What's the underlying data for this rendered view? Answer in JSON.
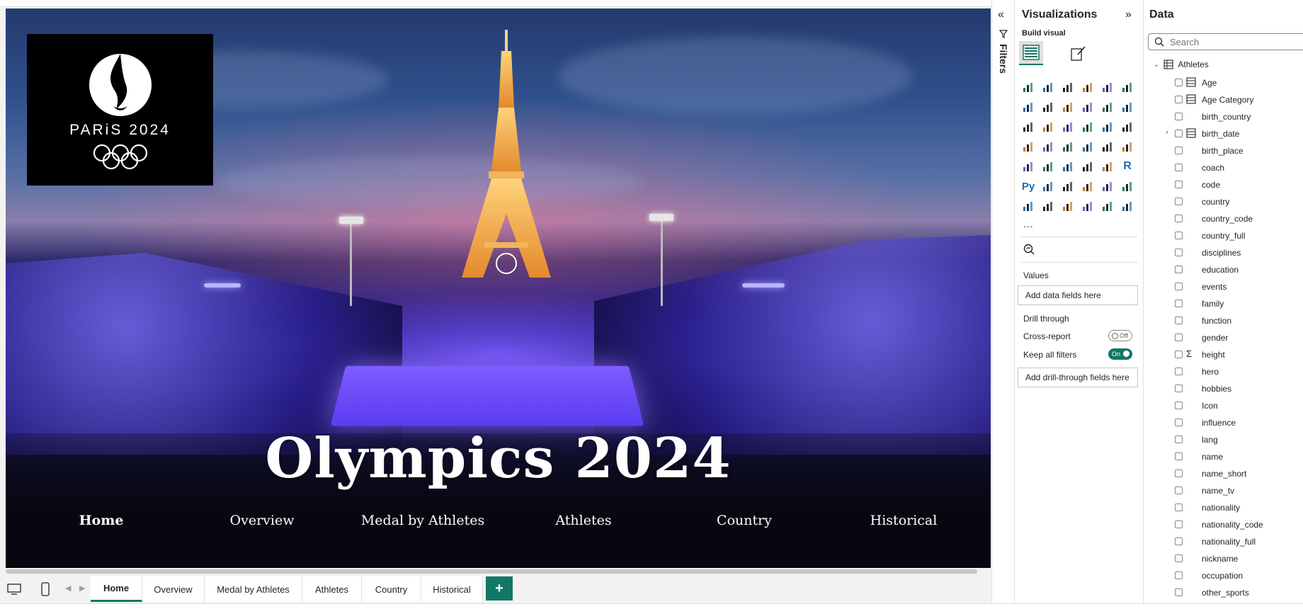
{
  "report": {
    "logo_text": "PARiS 2024",
    "hero_title": "Olympics 2024",
    "nav_links": [
      "Home",
      "Overview",
      "Medal by Athletes",
      "Athletes",
      "Country",
      "Historical"
    ]
  },
  "page_tabs": [
    "Home",
    "Overview",
    "Medal by Athletes",
    "Athletes",
    "Country",
    "Historical"
  ],
  "active_tab": "Home",
  "add_page_label": "+",
  "filters": {
    "label": "Filters"
  },
  "visualizations": {
    "title": "Visualizations",
    "build_visual_label": "Build visual",
    "more_label": "...",
    "values_label": "Values",
    "values_placeholder": "Add data fields here",
    "drill_through_label": "Drill through",
    "cross_report_label": "Cross-report",
    "cross_report_state": "Off",
    "keep_filters_label": "Keep all filters",
    "keep_filters_state": "On",
    "drill_placeholder": "Add drill-through fields here",
    "r_label": "R",
    "py_label": "Py"
  },
  "data_pane": {
    "title": "Data",
    "search_placeholder": "Search",
    "table_name": "Athletes",
    "fields": [
      {
        "name": "Age",
        "icon": "measure-table-icon"
      },
      {
        "name": "Age Category",
        "icon": "calc-column-icon"
      },
      {
        "name": "birth_country",
        "icon": ""
      },
      {
        "name": "birth_date",
        "icon": "date-hierarchy-icon"
      },
      {
        "name": "birth_place",
        "icon": ""
      },
      {
        "name": "coach",
        "icon": ""
      },
      {
        "name": "code",
        "icon": ""
      },
      {
        "name": "country",
        "icon": ""
      },
      {
        "name": "country_code",
        "icon": ""
      },
      {
        "name": "country_full",
        "icon": ""
      },
      {
        "name": "disciplines",
        "icon": ""
      },
      {
        "name": "education",
        "icon": ""
      },
      {
        "name": "events",
        "icon": ""
      },
      {
        "name": "family",
        "icon": ""
      },
      {
        "name": "function",
        "icon": ""
      },
      {
        "name": "gender",
        "icon": ""
      },
      {
        "name": "height",
        "icon": "sigma-icon"
      },
      {
        "name": "hero",
        "icon": ""
      },
      {
        "name": "hobbies",
        "icon": ""
      },
      {
        "name": "Icon",
        "icon": ""
      },
      {
        "name": "influence",
        "icon": ""
      },
      {
        "name": "lang",
        "icon": ""
      },
      {
        "name": "name",
        "icon": ""
      },
      {
        "name": "name_short",
        "icon": ""
      },
      {
        "name": "name_tv",
        "icon": ""
      },
      {
        "name": "nationality",
        "icon": ""
      },
      {
        "name": "nationality_code",
        "icon": ""
      },
      {
        "name": "nationality_full",
        "icon": ""
      },
      {
        "name": "nickname",
        "icon": ""
      },
      {
        "name": "occupation",
        "icon": ""
      },
      {
        "name": "other_sports",
        "icon": ""
      }
    ]
  },
  "colors": {
    "accent": "#117865",
    "pane_bg": "#ffffff",
    "chrome_bg": "#f3f2f1"
  }
}
